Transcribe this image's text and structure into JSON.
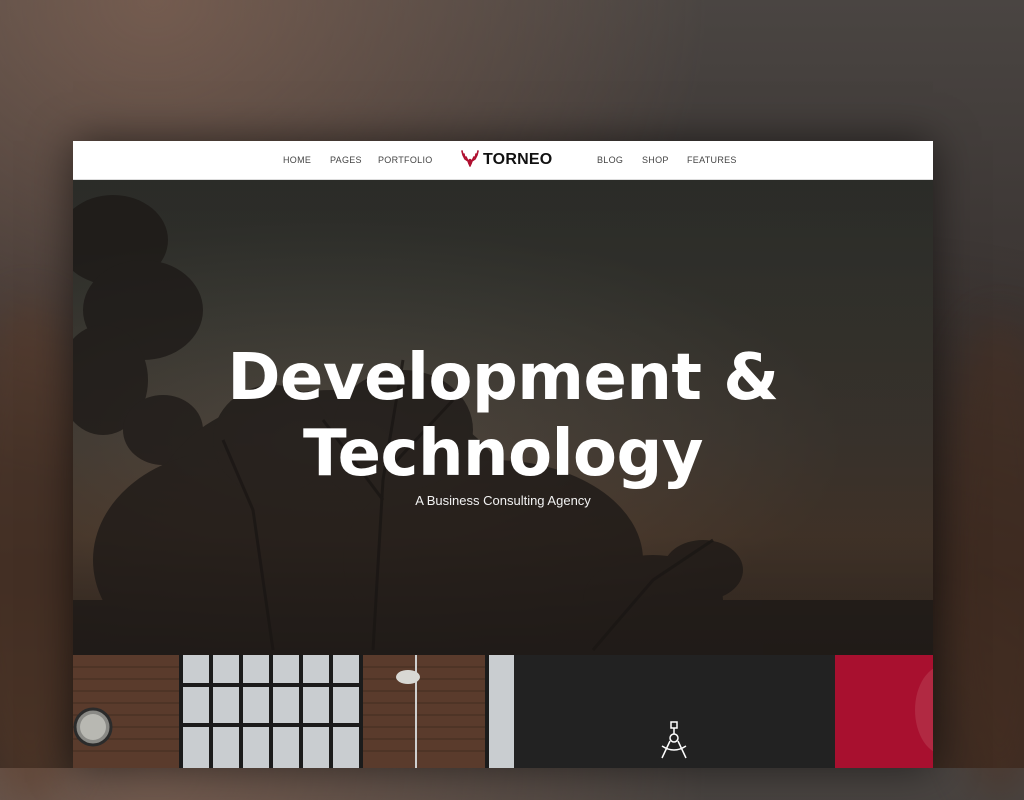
{
  "nav": {
    "items_left": [
      "HOME",
      "PAGES",
      "PORTFOLIO"
    ],
    "items_right": [
      "BLOG",
      "SHOP",
      "FEATURES"
    ],
    "logo_text": "TORNEO",
    "logo_icon": "deer-antlers-icon"
  },
  "hero": {
    "title_line1": "Development &",
    "title_line2": "Technology",
    "subtitle": "A Business Consulting Agency"
  },
  "tiles": {
    "photo_alt_icon": "brick-loft-photo",
    "service_icon": "pen-tool-icon"
  },
  "colors": {
    "accent": "#a8102f",
    "dark_tile": "#222222",
    "nav_bg": "#ffffff"
  }
}
